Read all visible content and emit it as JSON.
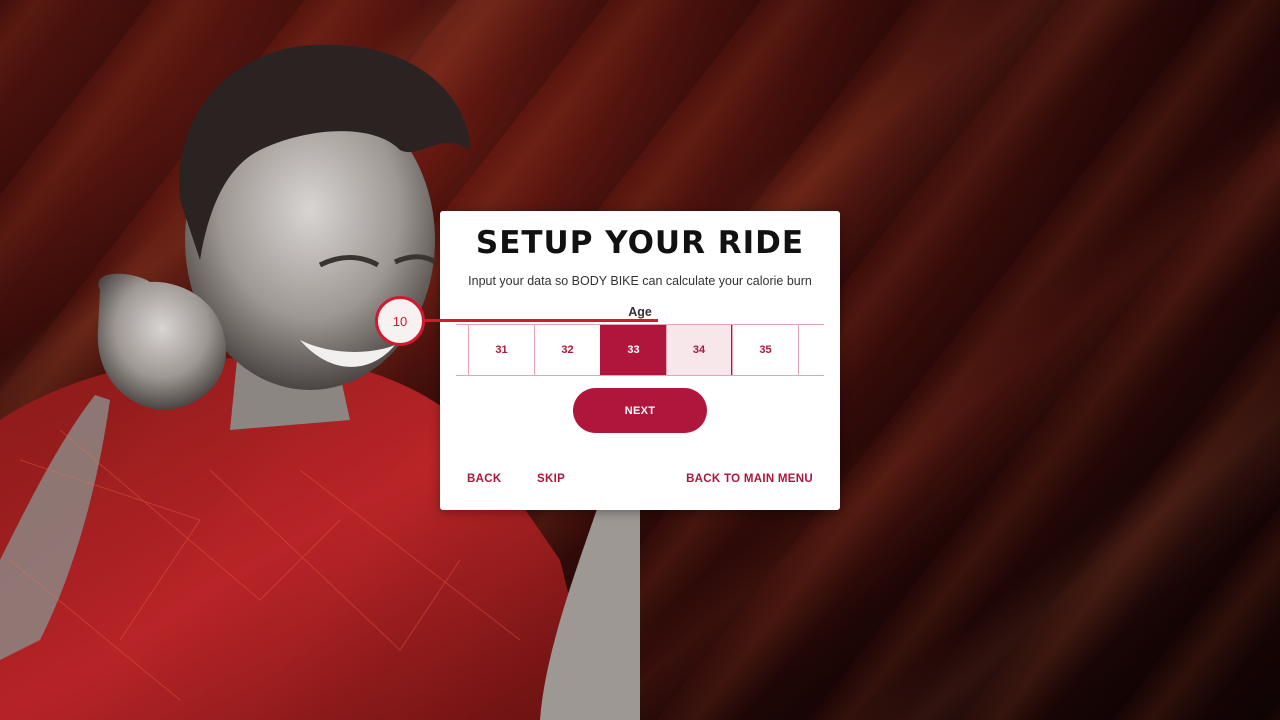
{
  "dialog": {
    "title": "SETUP YOUR RIDE",
    "subtitle": "Input your data so BODY BIKE can calculate your calorie burn",
    "field_label": "Age",
    "age_options": [
      "31",
      "32",
      "33",
      "34",
      "35"
    ],
    "selected_age": "33",
    "hovered_age": "34",
    "next_label": "NEXT",
    "back_label": "BACK",
    "skip_label": "SKIP",
    "main_menu_label": "BACK TO MAIN MENU"
  },
  "tutorial_badge": {
    "value": "10"
  },
  "colors": {
    "accent": "#b0153c",
    "badge": "#d2192f",
    "background": "#3c0d0a"
  }
}
